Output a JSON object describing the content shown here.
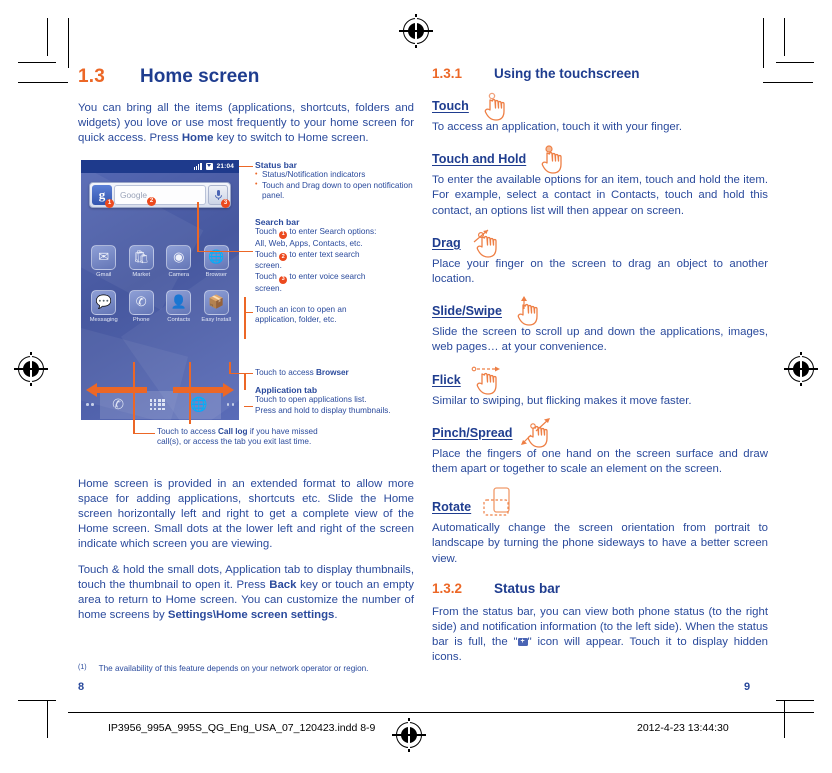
{
  "left_page": {
    "section": {
      "number": "1.3",
      "title": "Home screen"
    },
    "intro": "You can bring all the items (applications, shortcuts, folders and widgets) you love or use most frequently to your home screen for quick access. Press Home key to switch to Home screen.",
    "intro_bold": "Home",
    "phone": {
      "status_bar": {
        "time": "21:04"
      },
      "search_widget": {
        "placeholder": "Google",
        "badge_1": "1",
        "badge_2": "2",
        "badge_3": "3"
      },
      "apps": [
        {
          "label": "Gmail",
          "icon": "✉"
        },
        {
          "label": "Market",
          "icon": "🛍"
        },
        {
          "label": "Camera",
          "icon": "◉"
        },
        {
          "label": "Browser",
          "icon": "🌐"
        },
        {
          "label": "Messaging",
          "icon": "💬"
        },
        {
          "label": "Phone",
          "icon": "✆"
        },
        {
          "label": "Contacts",
          "icon": "👤"
        },
        {
          "label": "Easy Install",
          "icon": "📦"
        }
      ]
    },
    "callouts": {
      "status_bar_title": "Status bar",
      "status_bar_b1": "Status/Notification indicators",
      "status_bar_b2": "Touch and Drag down to open notification panel.",
      "search_bar_title": "Search bar",
      "search_line1_pre": "Touch",
      "search_line1_post": "to enter Search options:",
      "search_line2": "All, Web, Apps, Contacts, etc.",
      "search_line3_pre": "Touch",
      "search_line3_post": "to enter text search",
      "search_line4": "screen.",
      "search_line5_pre": "Touch",
      "search_line5_post": "to enter voice search",
      "search_line6": "screen.",
      "icon_open_l1": "Touch an icon to open an",
      "icon_open_l2": "application, folder, etc.",
      "browser_pre": "Touch to access ",
      "browser_bold": "Browser",
      "app_tab_title": "Application tab",
      "app_tab_l1": "Touch to open applications list.",
      "app_tab_l2": "Press and hold to display thumbnails.",
      "calllog_pre": "Touch to access ",
      "calllog_bold": "Call log",
      "calllog_post": " if you have missed",
      "calllog_l2": "call(s), or access the tab you exit last time."
    },
    "para2": "Home screen is provided in an extended format to allow more space for adding applications, shortcuts etc. Slide the Home screen horizontally left and right to get a complete view of the Home screen. Small dots at the lower left and right of the screen indicate which screen you are viewing.",
    "para3_a": "Touch & hold the small dots, Application tab to display thumbnails, touch the thumbnail to open it. Press ",
    "para3_b1": "Back",
    "para3_b": " key or touch an empty area to return to Home screen. You can customize the number of home screens by ",
    "para3_b2": "Settings\\Home screen settings",
    "para3_c": ".",
    "footnote_mark": "(1)",
    "footnote_text": "The availability of this feature depends on your network operator or region.",
    "page_number": "8"
  },
  "right_page": {
    "section_touchscreen": {
      "number": "1.3.1",
      "title": "Using the touchscreen"
    },
    "gestures": [
      {
        "title": "Touch",
        "desc": "To access an application, touch it with your finger.",
        "icon": "hand-touch-icon"
      },
      {
        "title": "Touch and Hold ",
        "desc": "To enter the available options for an item, touch and hold the item. For example, select a contact in Contacts, touch and hold this contact, an options list will then appear on screen.",
        "icon": "hand-touch-hold-icon"
      },
      {
        "title": "Drag",
        "desc": "Place your finger on the screen to drag an object to another location.",
        "icon": "hand-drag-icon"
      },
      {
        "title": "Slide/Swipe",
        "desc": "Slide the screen to scroll up and down the applications, images, web pages… at your convenience.",
        "icon": "hand-slide-icon"
      },
      {
        "title": "Flick",
        "desc": "Similar to swiping, but flicking makes it move faster.",
        "icon": "hand-flick-icon"
      },
      {
        "title": "Pinch/Spread",
        "desc": "Place the fingers of one hand on the screen surface and draw them apart or together to scale an element on the screen.",
        "icon": "hand-pinch-icon"
      },
      {
        "title": "Rotate",
        "desc": "Automatically change the screen orientation from portrait to landscape by turning the phone sideways to have a better screen view.",
        "icon": "rotate-phone-icon"
      }
    ],
    "section_statusbar": {
      "number": "1.3.2",
      "title": "Status bar"
    },
    "statusbar_text_a": "From the status bar, you can view both phone status (to the right side) and notification information (to the left side). When the status bar is full, the \"",
    "statusbar_text_b": "\"  icon will appear. Touch it to display hidden icons.",
    "page_number": "9"
  },
  "print_bar": {
    "file": "IP3956_995A_995S_QG_Eng_USA_07_120423.indd   8-9",
    "date": "2012-4-23   13:44:30"
  },
  "colors": {
    "orange": "#ec6726",
    "blue": "#2a4a9c",
    "heading_blue": "#1f3d8f"
  }
}
